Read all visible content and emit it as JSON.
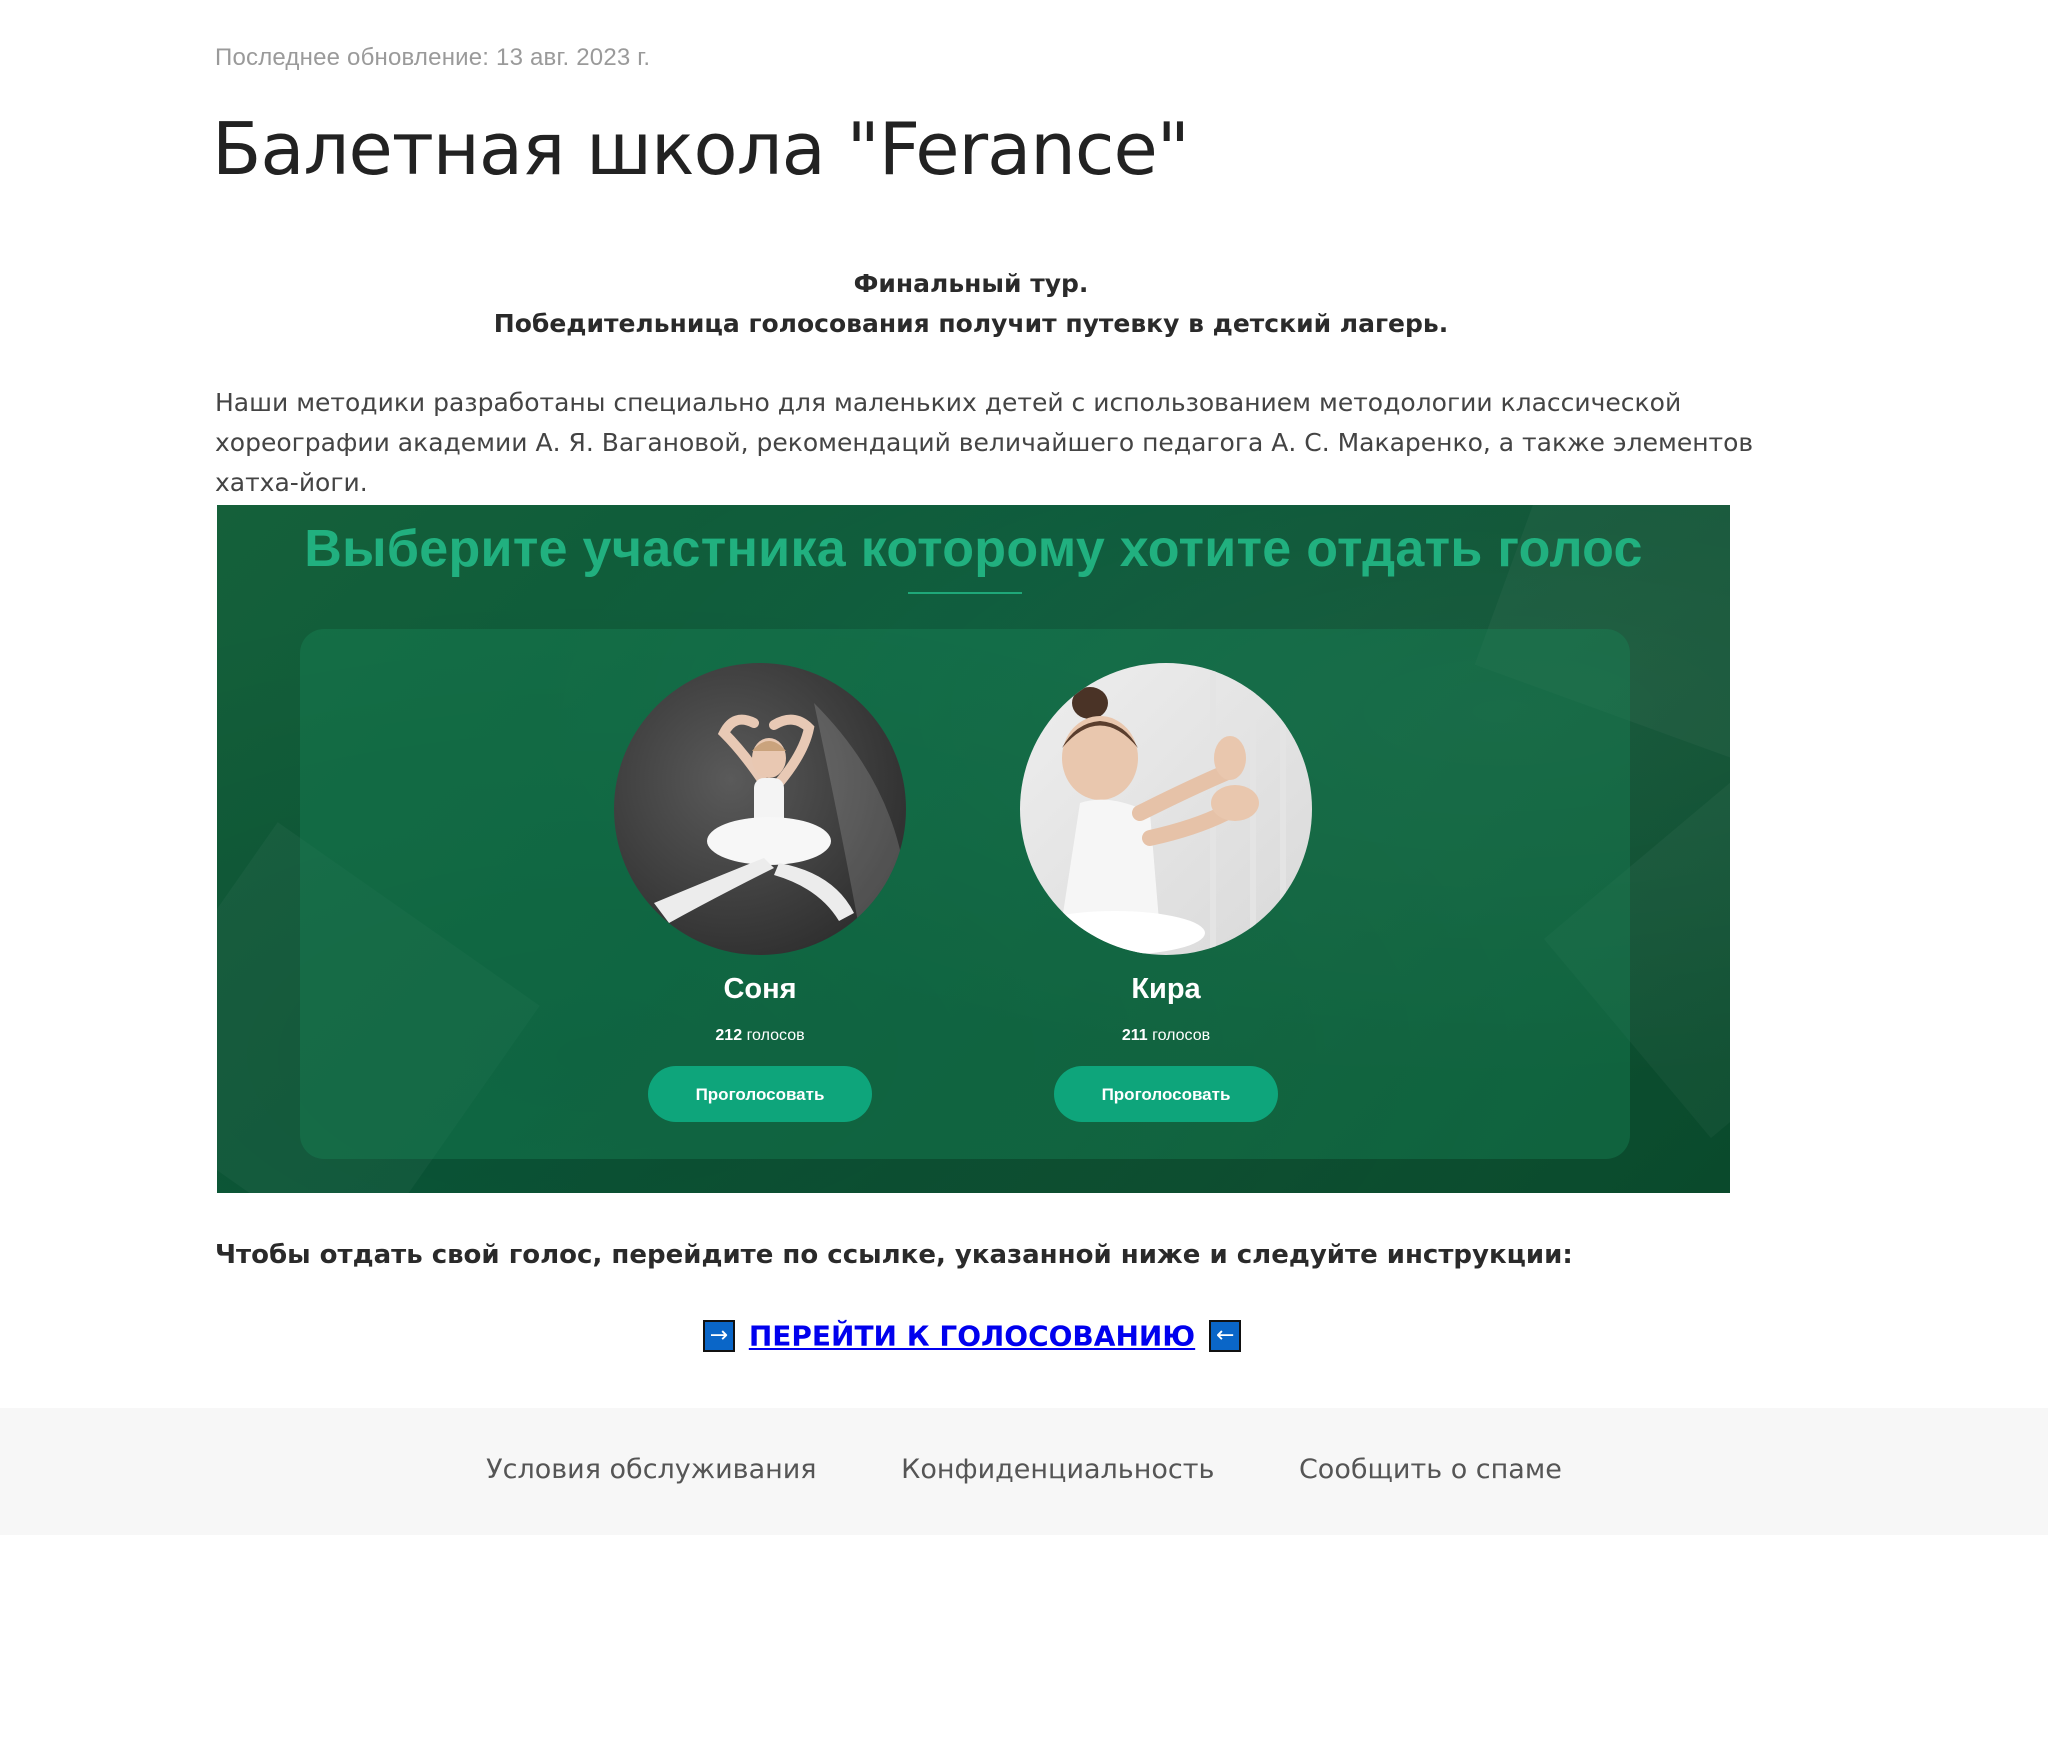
{
  "header": {
    "updated": "Последнее обновление: 13 авг. 2023 г.",
    "title": "Балетная школа \"Ferance\""
  },
  "lead": {
    "line1": "Финальный тур.",
    "line2": "Победительница голосования получит путевку в детский лагерь."
  },
  "description": "Наши методики разработаны специально для маленьких детей с использованием методологии классической хореографии академии А. Я. Вагановой, рекомендаций величайшего педагога А. С. Макаренко, а также элементов хатха-йоги.",
  "banner": {
    "heading": "Выберите участника которому хотите отдать голос",
    "accent_color": "#21b07f",
    "button_color": "#0ea57b",
    "contestants": [
      {
        "name": "Соня",
        "votes": "212",
        "votes_label": "голосов",
        "button": "Проголосовать"
      },
      {
        "name": "Кира",
        "votes": "211",
        "votes_label": "голосов",
        "button": "Проголосовать"
      }
    ]
  },
  "instruction": "Чтобы отдать свой голос, перейдите по ссылке, указанной ниже и следуйте инструкции:",
  "cta": {
    "left_arrow": "→",
    "link": "ПЕРЕЙТИ К ГОЛОСОВАНИЮ",
    "right_arrow": "←",
    "link_color": "#0000ee"
  },
  "footer": {
    "links": [
      "Условия обслуживания",
      "Конфиденциальность",
      "Сообщить о спаме"
    ]
  }
}
